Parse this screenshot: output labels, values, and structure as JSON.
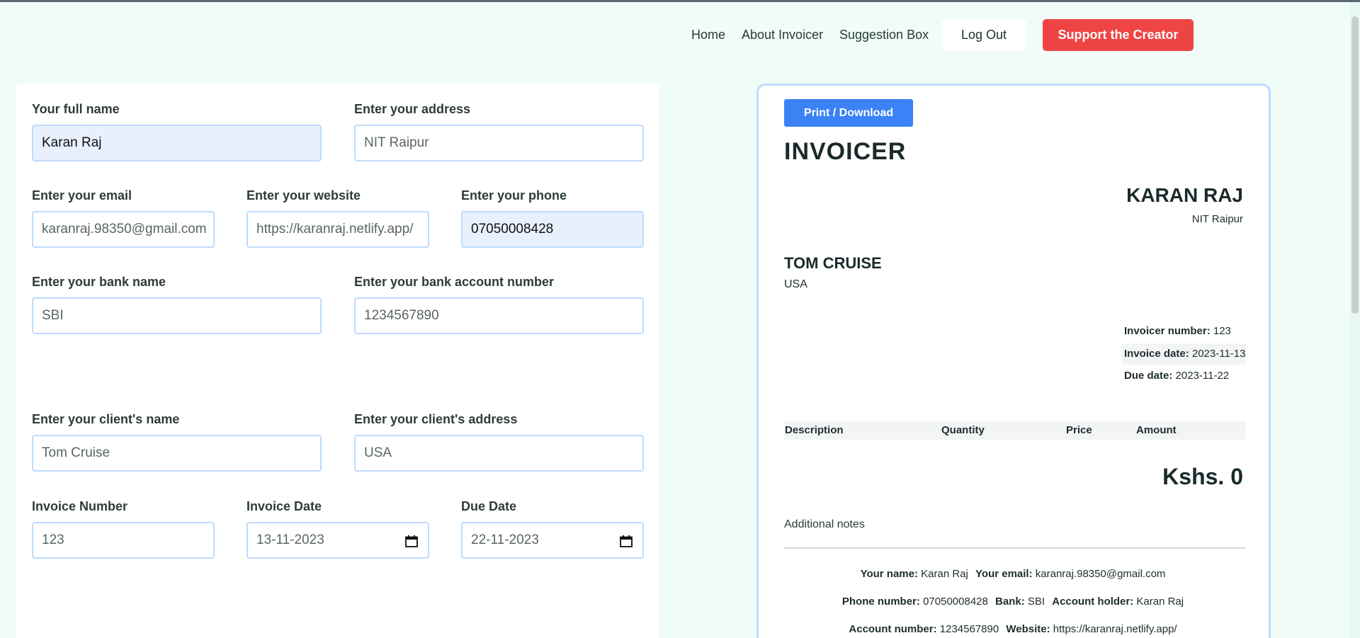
{
  "nav": {
    "links": [
      "Home",
      "About Invoicer",
      "Suggestion Box"
    ],
    "logout": "Log Out",
    "support": "Support the Creator"
  },
  "form": {
    "full_name": {
      "label": "Your full name",
      "value": "Karan Raj"
    },
    "address": {
      "label": "Enter your address",
      "value": "NIT Raipur"
    },
    "email": {
      "label": "Enter your email",
      "value": "karanraj.98350@gmail.com"
    },
    "website": {
      "label": "Enter your website",
      "value": "https://karanraj.netlify.app/"
    },
    "phone": {
      "label": "Enter your phone",
      "value": "07050008428"
    },
    "bank_name": {
      "label": "Enter your bank name",
      "value": "SBI"
    },
    "bank_account": {
      "label": "Enter your bank account number",
      "value": "1234567890"
    },
    "client_name": {
      "label": "Enter your client's name",
      "value": "Tom Cruise"
    },
    "client_address": {
      "label": "Enter your client's address",
      "value": "USA"
    },
    "invoice_number": {
      "label": "Invoice Number",
      "value": "123"
    },
    "invoice_date": {
      "label": "Invoice Date",
      "value": "13-11-2023"
    },
    "due_date": {
      "label": "Due Date",
      "value": "22-11-2023"
    }
  },
  "preview": {
    "print_button": "Print / Download",
    "title": "INVOICER",
    "from_name": "KARAN RAJ",
    "from_address": "NIT Raipur",
    "to_name": "TOM CRUISE",
    "to_address": "USA",
    "invoice_number_label": "Invoicer number:",
    "invoice_number": "123",
    "invoice_date_label": "Invoice date:",
    "invoice_date": "2023-11-13",
    "due_date_label": "Due date:",
    "due_date": "2023-11-22",
    "table_headers": [
      "Description",
      "Quantity",
      "Price",
      "Amount"
    ],
    "total": "Kshs. 0",
    "notes_label": "Additional notes",
    "footer": {
      "your_name_label": "Your name:",
      "your_name": "Karan Raj",
      "your_email_label": "Your email:",
      "your_email": "karanraj.98350@gmail.com",
      "phone_label": "Phone number:",
      "phone": "07050008428",
      "bank_label": "Bank:",
      "bank": "SBI",
      "holder_label": "Account holder:",
      "holder": "Karan Raj",
      "account_label": "Account number:",
      "account": "1234567890",
      "website_label": "Website:",
      "website": "https://karanraj.netlify.app/"
    }
  }
}
